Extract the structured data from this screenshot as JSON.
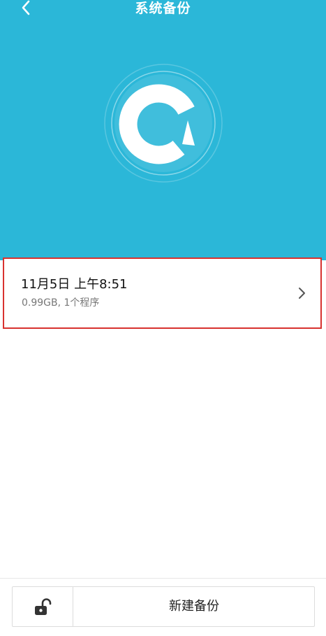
{
  "header": {
    "title": "系统备份",
    "back_icon": "chevron-left-icon"
  },
  "theme": {
    "hero_color": "#2bb7d8",
    "highlight_border": "#d8322f"
  },
  "logo": {
    "icon": "backup-restore-icon"
  },
  "backups": [
    {
      "date": "11月5日 上午8:51",
      "info": "0.99GB, 1个程序"
    }
  ],
  "bottom_bar": {
    "lock_icon": "unlock-icon",
    "new_backup_label": "新建备份"
  }
}
